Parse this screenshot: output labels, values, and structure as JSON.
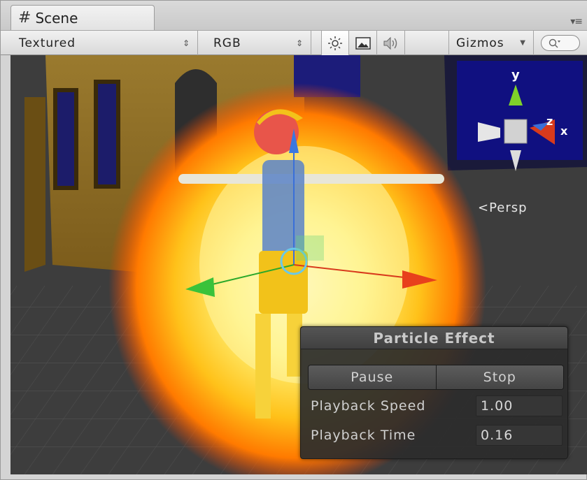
{
  "tab": {
    "label": "Scene"
  },
  "toolbar": {
    "render_mode": "Textured",
    "channel": "RGB",
    "gizmos": "Gizmos",
    "icons": [
      "sun-icon",
      "image-icon",
      "speaker-icon",
      "search-icon"
    ]
  },
  "viewport": {
    "projection_label": "Persp",
    "axis_labels": {
      "y": "y",
      "z": "z",
      "x": "x"
    }
  },
  "particle_panel": {
    "title": "Particle Effect",
    "pause_label": "Pause",
    "stop_label": "Stop",
    "speed_label": "Playback Speed",
    "speed_value": "1.00",
    "time_label": "Playback Time",
    "time_value": "0.16"
  },
  "colors": {
    "fire_core": "#fff27a",
    "fire_outer": "#ff6a00",
    "wall": "#8a6a22",
    "axis_y": "#7fd12a",
    "axis_x": "#d83a1c",
    "axis_z": "#3a6fd8"
  }
}
